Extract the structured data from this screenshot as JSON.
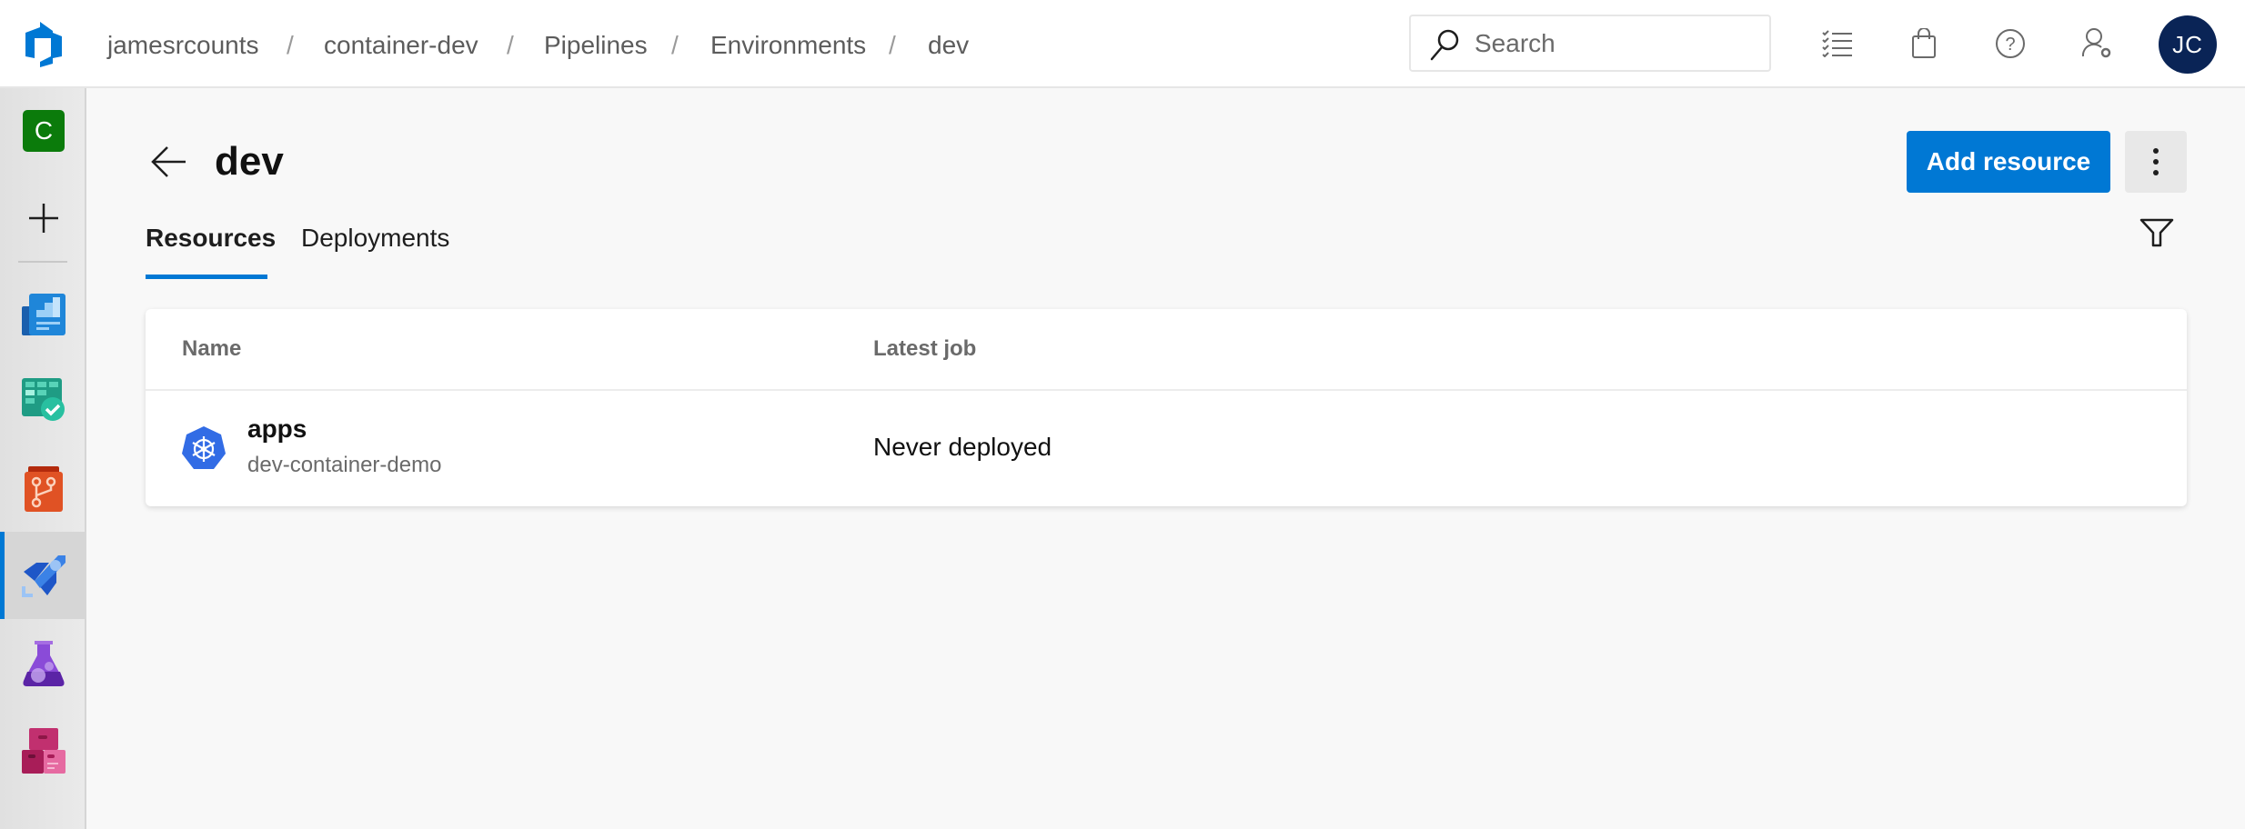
{
  "topbar": {
    "breadcrumb": [
      "jamesrcounts",
      "container-dev",
      "Pipelines",
      "Environments",
      "dev"
    ],
    "separator": "/",
    "search": {
      "placeholder": "Search",
      "value": ""
    },
    "icons": [
      "work-items-icon",
      "marketplace-bag-icon",
      "help-icon",
      "user-settings-icon"
    ],
    "avatar_initials": "JC"
  },
  "sidebar": {
    "org_initial": "C",
    "items": [
      {
        "name": "add",
        "label": "New project"
      },
      {
        "name": "overview",
        "label": "Overview"
      },
      {
        "name": "boards",
        "label": "Boards"
      },
      {
        "name": "repos",
        "label": "Repos"
      },
      {
        "name": "pipelines",
        "label": "Pipelines",
        "selected": true
      },
      {
        "name": "test-plans",
        "label": "Test Plans"
      },
      {
        "name": "artifacts",
        "label": "Artifacts"
      }
    ]
  },
  "page": {
    "title": "dev",
    "add_button": "Add resource",
    "tabs": [
      {
        "label": "Resources",
        "active": true
      },
      {
        "label": "Deployments",
        "active": false
      }
    ]
  },
  "table": {
    "columns": [
      "Name",
      "Latest job"
    ],
    "rows": [
      {
        "icon": "kubernetes-icon",
        "name": "apps",
        "subtitle": "dev-container-demo",
        "latest_job": "Never deployed"
      }
    ]
  },
  "colors": {
    "accent": "#0078d4",
    "avatar": "#0a2456",
    "org_tile": "#0b7b0b"
  }
}
